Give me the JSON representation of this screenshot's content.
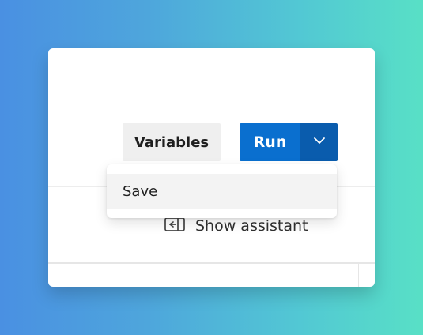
{
  "toolbar": {
    "variables_label": "Variables",
    "run_label": "Run",
    "run_more_icon": "chevron-down-icon",
    "colors": {
      "primary": "#0a6fcf",
      "primary_dark": "#0a5cad",
      "secondary_bg": "#efefef"
    }
  },
  "dropdown": {
    "items": [
      {
        "label": "Save"
      }
    ]
  },
  "assistant": {
    "label": "Show assistant",
    "icon": "show-assistant-icon"
  }
}
